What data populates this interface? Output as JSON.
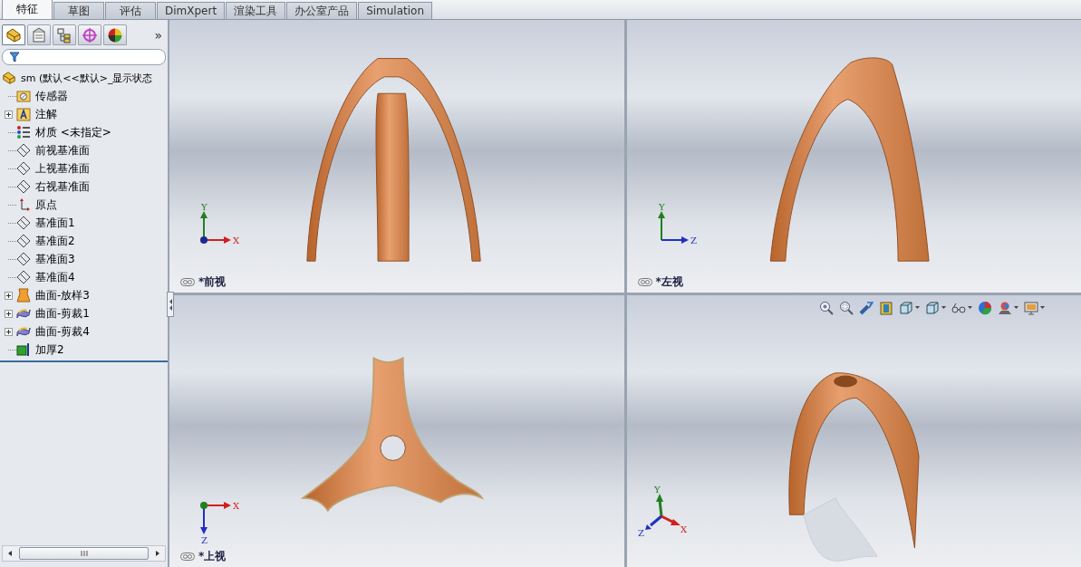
{
  "tabs": [
    {
      "label": "特征",
      "selected": true
    },
    {
      "label": "草图",
      "selected": false
    },
    {
      "label": "评估",
      "selected": false
    },
    {
      "label": "DimXpert",
      "selected": false
    },
    {
      "label": "渲染工具",
      "selected": false
    },
    {
      "label": "办公室产品",
      "selected": false
    },
    {
      "label": "Simulation",
      "selected": false
    }
  ],
  "panel_tabs": [
    {
      "kind": "feature",
      "selected": true
    },
    {
      "kind": "property",
      "selected": false
    },
    {
      "kind": "config",
      "selected": false
    },
    {
      "kind": "dimxpert",
      "selected": false
    },
    {
      "kind": "display",
      "selected": false
    }
  ],
  "panel_more": "»",
  "tree": {
    "root": "sm  (默认<<默认>_显示状态",
    "items": [
      {
        "label": "传感器",
        "kind": "sensor",
        "expandable": false
      },
      {
        "label": "注解",
        "kind": "annotation",
        "expandable": true
      },
      {
        "label": "材质 <未指定>",
        "kind": "material",
        "expandable": false
      },
      {
        "label": "前视基准面",
        "kind": "plane",
        "expandable": false
      },
      {
        "label": "上视基准面",
        "kind": "plane",
        "expandable": false
      },
      {
        "label": "右视基准面",
        "kind": "plane",
        "expandable": false
      },
      {
        "label": "原点",
        "kind": "origin",
        "expandable": false
      },
      {
        "label": "基准面1",
        "kind": "plane",
        "expandable": false
      },
      {
        "label": "基准面2",
        "kind": "plane",
        "expandable": false
      },
      {
        "label": "基准面3",
        "kind": "plane",
        "expandable": false
      },
      {
        "label": "基准面4",
        "kind": "plane",
        "expandable": false
      },
      {
        "label": "曲面-放样3",
        "kind": "loft",
        "expandable": true
      },
      {
        "label": "曲面-剪裁1",
        "kind": "trim",
        "expandable": true
      },
      {
        "label": "曲面-剪裁4",
        "kind": "trim",
        "expandable": true
      },
      {
        "label": "加厚2",
        "kind": "thicken",
        "expandable": false
      }
    ]
  },
  "viewports": [
    {
      "kind": "front",
      "label": "*前视",
      "axes": [
        "Y",
        "X"
      ]
    },
    {
      "kind": "left",
      "label": "*左视",
      "axes": [
        "Y",
        "Z"
      ]
    },
    {
      "kind": "top",
      "label": "*上视",
      "axes": [
        "X",
        "Z"
      ]
    },
    {
      "kind": "iso",
      "axes": [
        "Y",
        "Z",
        "X"
      ],
      "toolbar": [
        {
          "kind": "zoom-fit",
          "dropdown": false
        },
        {
          "kind": "zoom-area",
          "dropdown": false
        },
        {
          "kind": "previous-view",
          "dropdown": false
        },
        {
          "kind": "section",
          "dropdown": false
        },
        {
          "kind": "view-orientation",
          "dropdown": true
        },
        {
          "kind": "display-style",
          "dropdown": true
        },
        {
          "kind": "hide-show",
          "dropdown": true
        },
        {
          "kind": "appearance",
          "dropdown": false
        },
        {
          "kind": "scene",
          "dropdown": true
        },
        {
          "kind": "view-settings",
          "dropdown": true
        }
      ]
    }
  ]
}
